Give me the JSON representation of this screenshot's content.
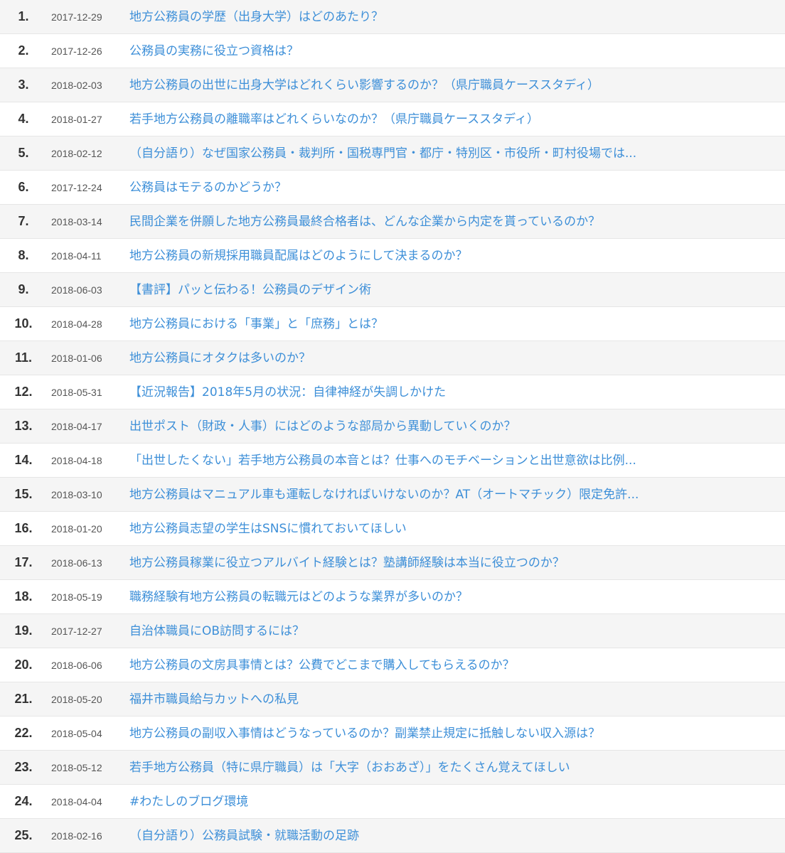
{
  "ranking": [
    {
      "rank": "1.",
      "date": "2017-12-29",
      "title": "地方公務員の学歴（出身大学）はどのあたり？"
    },
    {
      "rank": "2.",
      "date": "2017-12-26",
      "title": "公務員の実務に役立つ資格は？"
    },
    {
      "rank": "3.",
      "date": "2018-02-03",
      "title": "地方公務員の出世に出身大学はどれくらい影響するのか？（県庁職員ケーススタディ）"
    },
    {
      "rank": "4.",
      "date": "2018-01-27",
      "title": "若手地方公務員の離職率はどれくらいなのか？（県庁職員ケーススタディ）"
    },
    {
      "rank": "5.",
      "date": "2018-02-12",
      "title": "（自分語り）なぜ国家公務員・裁判所・国税専門官・都庁・特別区・市役所・町村役場では..."
    },
    {
      "rank": "6.",
      "date": "2017-12-24",
      "title": "公務員はモテるのかどうか？"
    },
    {
      "rank": "7.",
      "date": "2018-03-14",
      "title": "民間企業を併願した地方公務員最終合格者は、どんな企業から内定を貰っているのか？"
    },
    {
      "rank": "8.",
      "date": "2018-04-11",
      "title": "地方公務員の新規採用職員配属はどのようにして決まるのか？"
    },
    {
      "rank": "9.",
      "date": "2018-06-03",
      "title": "【書評】パッと伝わる！公務員のデザイン術"
    },
    {
      "rank": "10.",
      "date": "2018-04-28",
      "title": "地方公務員における「事業」と「庶務」とは？"
    },
    {
      "rank": "11.",
      "date": "2018-01-06",
      "title": "地方公務員にオタクは多いのか？"
    },
    {
      "rank": "12.",
      "date": "2018-05-31",
      "title": "【近況報告】2018年5月の状況：自律神経が失調しかけた"
    },
    {
      "rank": "13.",
      "date": "2018-04-17",
      "title": "出世ポスト（財政・人事）にはどのような部局から異動していくのか？"
    },
    {
      "rank": "14.",
      "date": "2018-04-18",
      "title": "「出世したくない」若手地方公務員の本音とは？仕事へのモチベーションと出世意欲は比例..."
    },
    {
      "rank": "15.",
      "date": "2018-03-10",
      "title": "地方公務員はマニュアル車も運転しなければいけないのか？AT（オートマチック）限定免許..."
    },
    {
      "rank": "16.",
      "date": "2018-01-20",
      "title": "地方公務員志望の学生はSNSに慣れておいてほしい"
    },
    {
      "rank": "17.",
      "date": "2018-06-13",
      "title": "地方公務員稼業に役立つアルバイト経験とは？塾講師経験は本当に役立つのか？"
    },
    {
      "rank": "18.",
      "date": "2018-05-19",
      "title": "職務経験有地方公務員の転職元はどのような業界が多いのか？"
    },
    {
      "rank": "19.",
      "date": "2017-12-27",
      "title": "自治体職員にOB訪問するには？"
    },
    {
      "rank": "20.",
      "date": "2018-06-06",
      "title": "地方公務員の文房具事情とは？公費でどこまで購入してもらえるのか？"
    },
    {
      "rank": "21.",
      "date": "2018-05-20",
      "title": "福井市職員給与カットへの私見"
    },
    {
      "rank": "22.",
      "date": "2018-05-04",
      "title": "地方公務員の副収入事情はどうなっているのか？副業禁止規定に抵触しない収入源は？"
    },
    {
      "rank": "23.",
      "date": "2018-05-12",
      "title": "若手地方公務員（特に県庁職員）は「大字（おおあざ）」をたくさん覚えてほしい"
    },
    {
      "rank": "24.",
      "date": "2018-04-04",
      "title": "#わたしのブログ環境"
    },
    {
      "rank": "25.",
      "date": "2018-02-16",
      "title": "（自分語り）公務員試験・就職活動の足跡"
    }
  ]
}
